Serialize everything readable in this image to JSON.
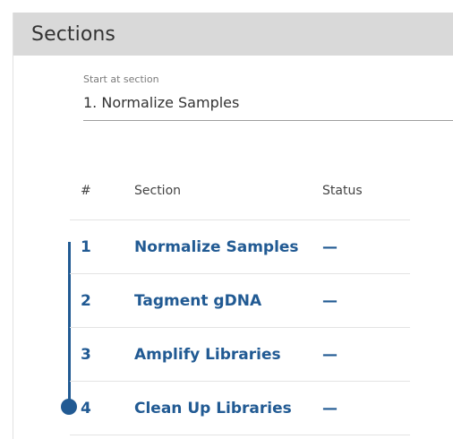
{
  "panel": {
    "title": "Sections"
  },
  "start": {
    "label": "Start at section",
    "value": "1. Normalize Samples"
  },
  "table": {
    "headers": {
      "num": "#",
      "section": "Section",
      "status": "Status"
    },
    "rows": [
      {
        "num": "1",
        "section": "Normalize Samples",
        "status": "—"
      },
      {
        "num": "2",
        "section": "Tagment gDNA",
        "status": "—"
      },
      {
        "num": "3",
        "section": "Amplify Libraries",
        "status": "—"
      },
      {
        "num": "4",
        "section": "Clean Up Libraries",
        "status": "—"
      }
    ]
  },
  "colors": {
    "accent": "#215a93",
    "header_bg": "#d9d9d9"
  }
}
